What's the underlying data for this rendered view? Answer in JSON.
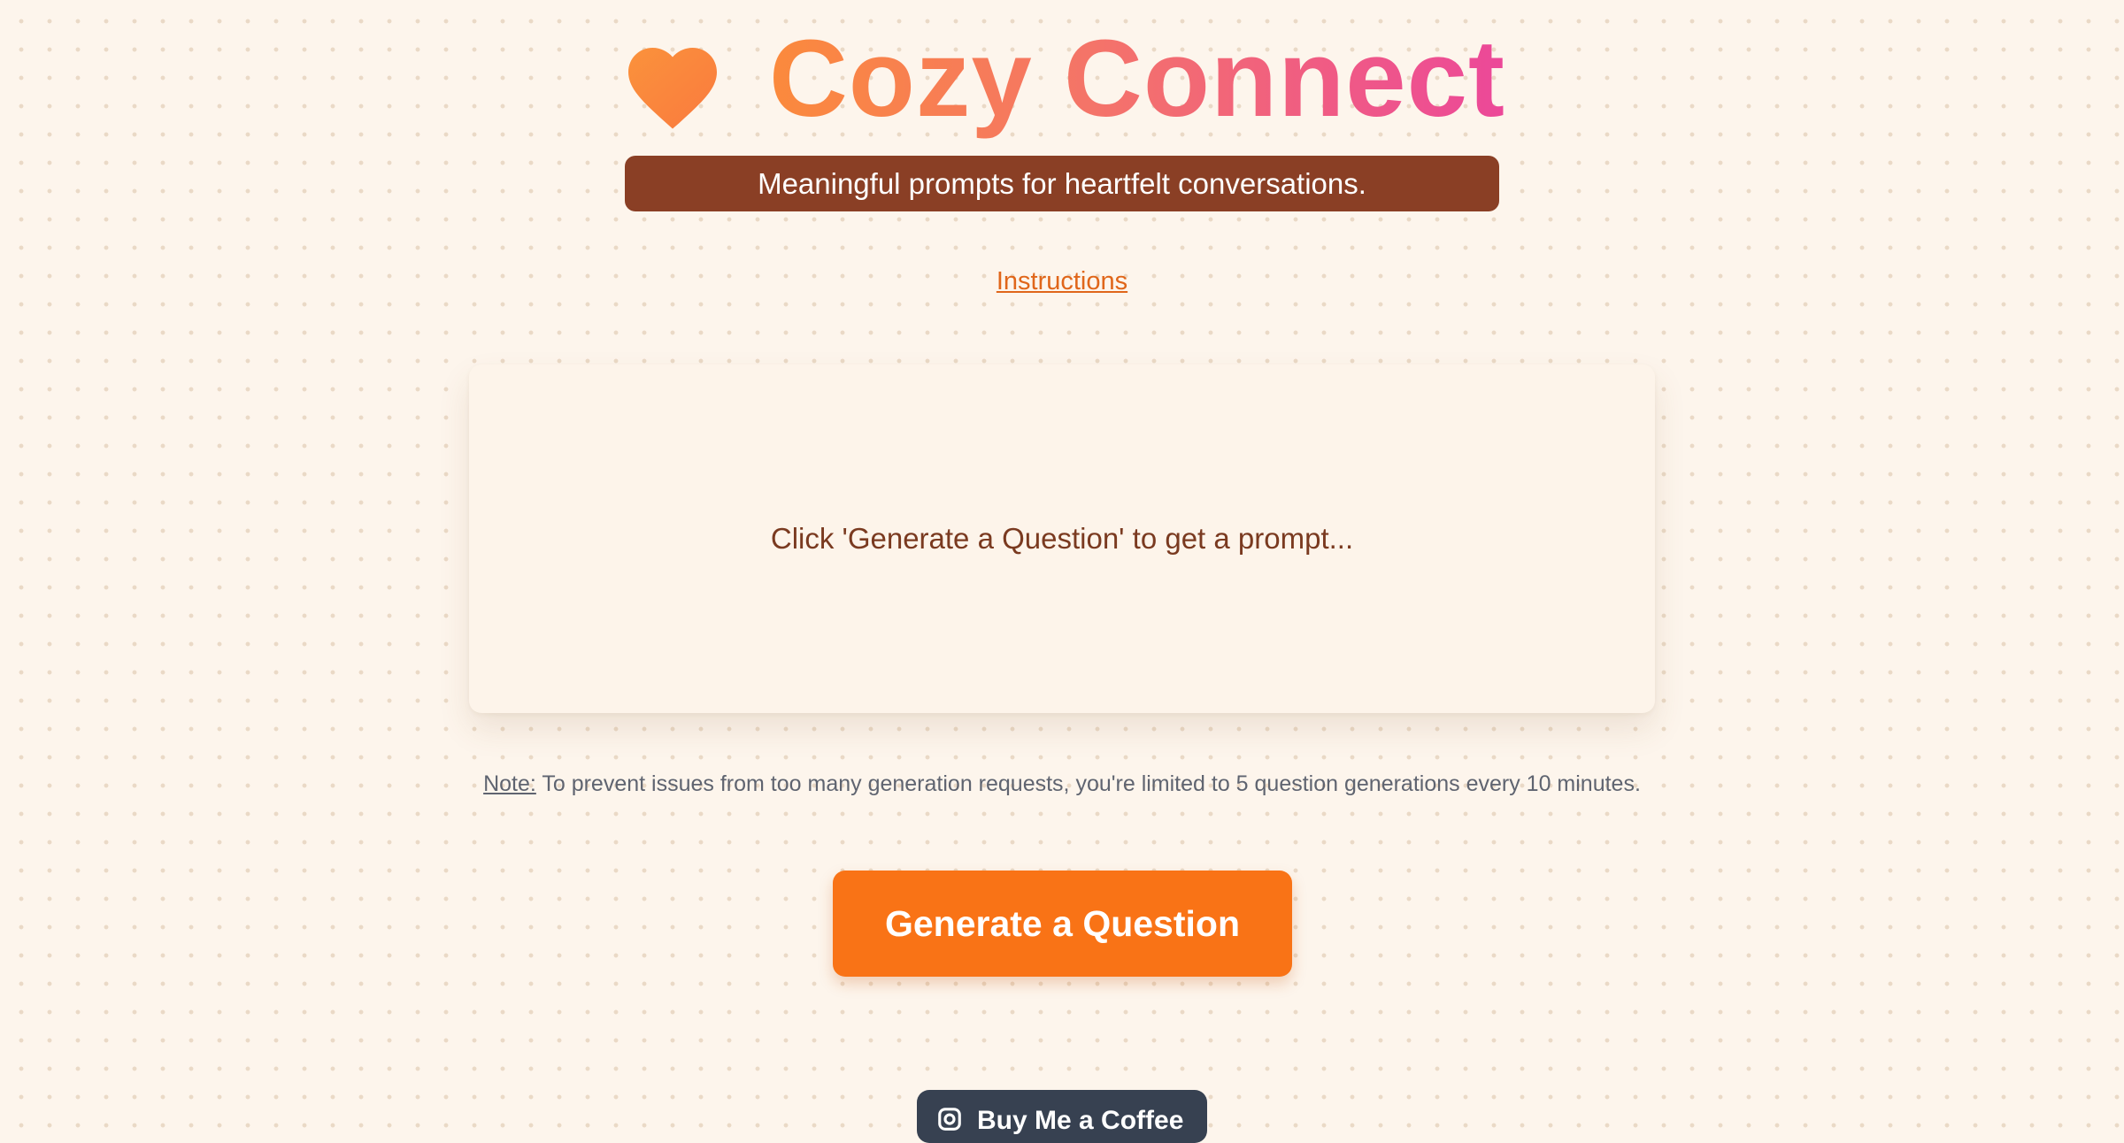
{
  "header": {
    "icon": "heart-icon",
    "title": "Cozy Connect",
    "tagline": "Meaningful prompts for heartfelt conversations."
  },
  "nav": {
    "instructions_label": "Instructions"
  },
  "prompt_card": {
    "placeholder": "Click 'Generate a Question' to get a prompt..."
  },
  "note": {
    "label": "Note:",
    "text": " To prevent issues from too many generation requests, you're limited to 5 question generations every 10 minutes."
  },
  "actions": {
    "generate_label": "Generate a Question",
    "coffee_label": "Buy Me a Coffee",
    "coffee_icon": "coffee-cup-icon"
  },
  "colors": {
    "background": "#fdf5ec",
    "title_gradient_start": "#fb8a3c",
    "title_gradient_end": "#ec4899",
    "tagline_bg": "#8a3f25",
    "link": "#e0661a",
    "prompt_text": "#7a3a20",
    "primary_button": "#f97316",
    "coffee_button": "#374151"
  }
}
